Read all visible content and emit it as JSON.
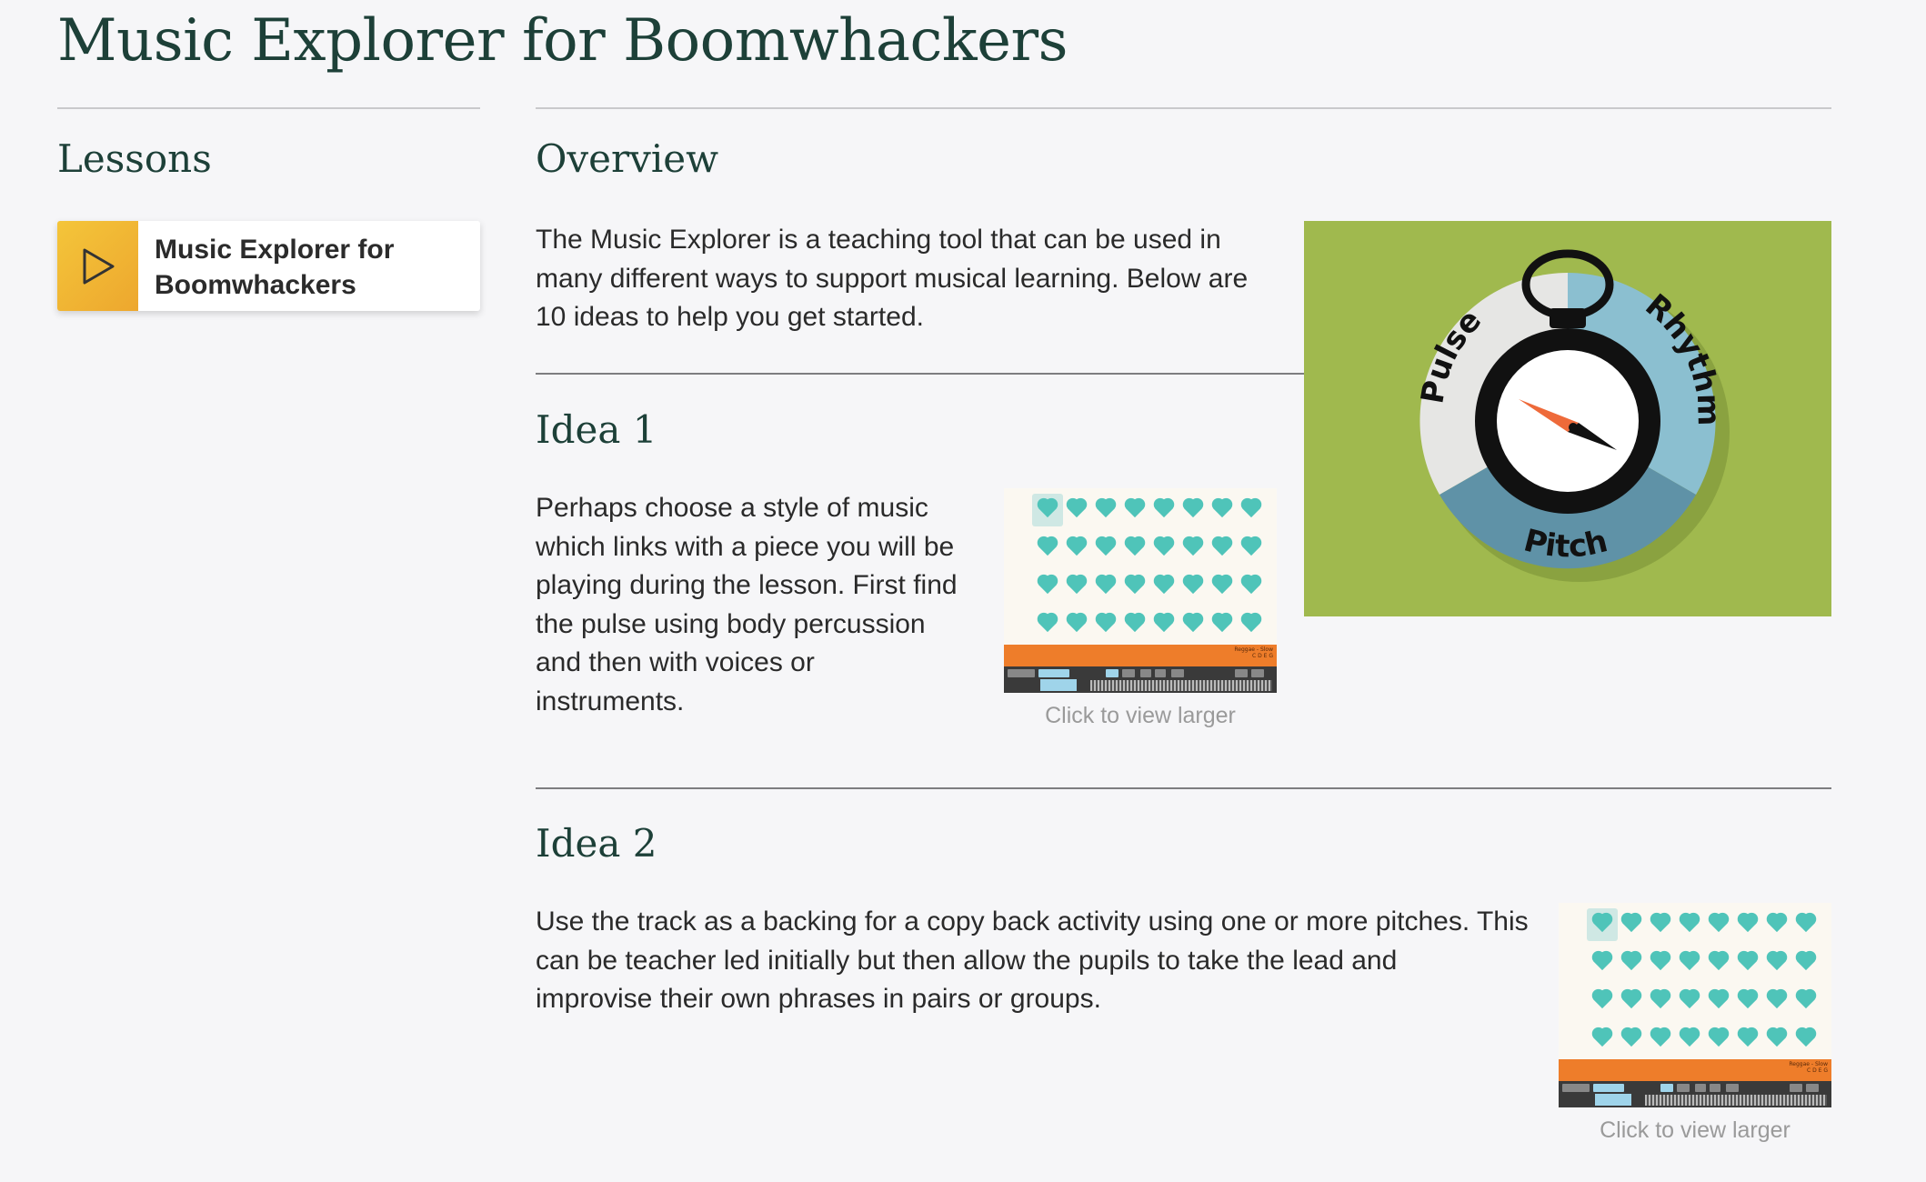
{
  "page": {
    "title": "Music Explorer for Boomwhackers"
  },
  "sidebar": {
    "heading": "Lessons",
    "lesson_card": {
      "line1": "Music Explorer for",
      "line2": "Boomwhackers",
      "icon": "play-icon",
      "accent": "#f0b535"
    }
  },
  "overview": {
    "heading": "Overview",
    "text_lines": [
      "The Music Explorer is a teaching tool that can be used in",
      "many different ways to support musical learning. Below are",
      "10 ideas to help you get started."
    ],
    "image": {
      "labels": [
        "Pulse",
        "Rhythm",
        "Pitch"
      ],
      "background": "#a0b94e"
    }
  },
  "ideas": [
    {
      "heading": "Idea 1",
      "text_lines": [
        "Perhaps choose a style of music",
        "which links with a piece you will be",
        "playing during the lesson. First find",
        "the pulse using body percussion",
        "and then with voices or",
        "instruments."
      ],
      "caption": "Click to view larger",
      "screenshot_tag": "Reggae - Slow",
      "screenshot_sub": "C D E G"
    },
    {
      "heading": "Idea 2",
      "text_lines": [
        "Use the track as a backing for a copy back activity using one or more pitches. This",
        "can be teacher led initially but then allow the pupils to take the lead and",
        "improvise their own phrases in pairs or groups."
      ],
      "caption": "Click to view larger",
      "screenshot_tag": "Reggae - Slow",
      "screenshot_sub": "C D E G"
    }
  ],
  "colors": {
    "heading": "#1d4038",
    "heart": "#4fc4b9",
    "orange_bar": "#ee7d2a"
  }
}
